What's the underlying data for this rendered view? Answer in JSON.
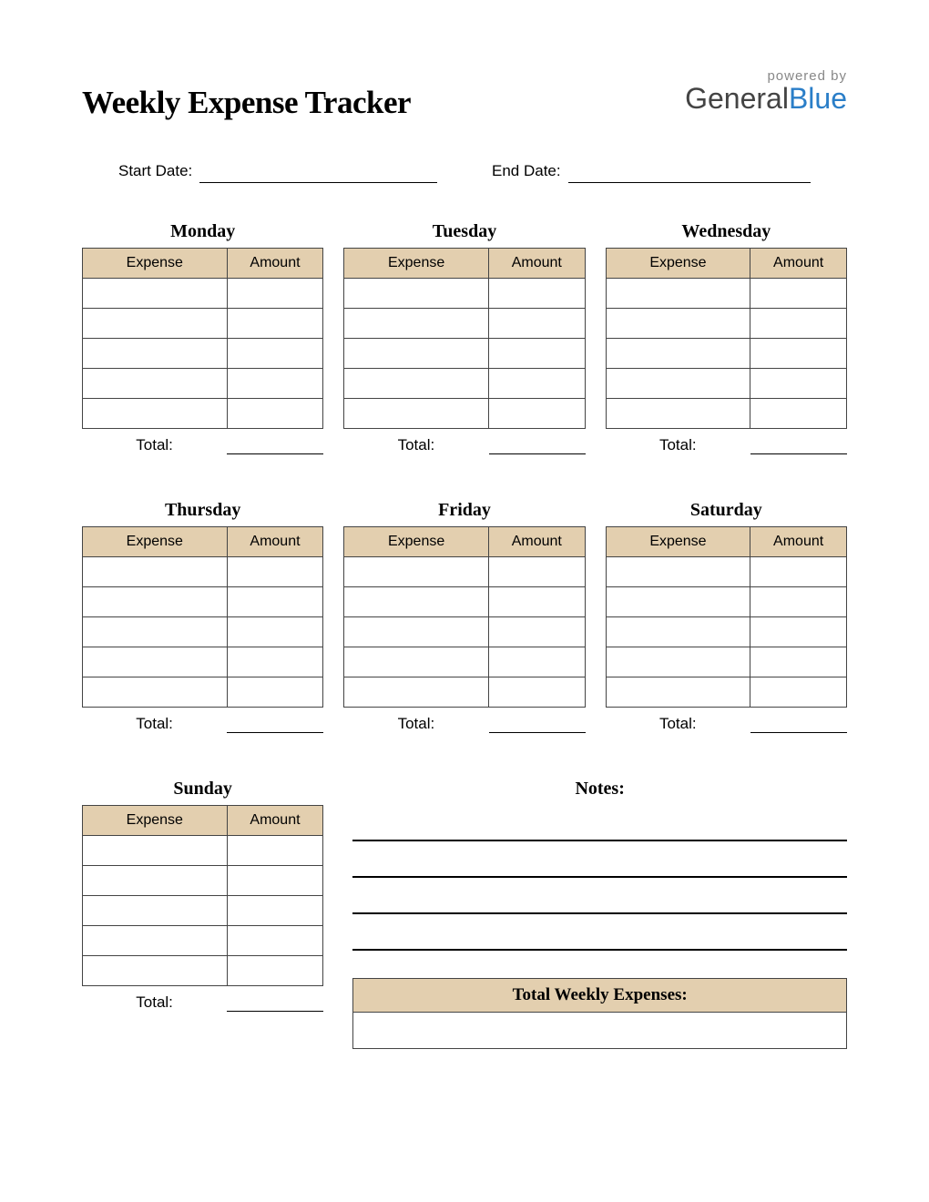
{
  "title": "Weekly Expense Tracker",
  "logo": {
    "powered": "powered by",
    "brand_part1": "General",
    "brand_part2": "Blue"
  },
  "dates": {
    "start_label": "Start Date:",
    "start_value": "",
    "end_label": "End Date:",
    "end_value": ""
  },
  "columns": {
    "expense": "Expense",
    "amount": "Amount"
  },
  "total_label": "Total:",
  "days": [
    {
      "name": "Monday",
      "rows": [
        {
          "expense": "",
          "amount": ""
        },
        {
          "expense": "",
          "amount": ""
        },
        {
          "expense": "",
          "amount": ""
        },
        {
          "expense": "",
          "amount": ""
        },
        {
          "expense": "",
          "amount": ""
        }
      ],
      "total": ""
    },
    {
      "name": "Tuesday",
      "rows": [
        {
          "expense": "",
          "amount": ""
        },
        {
          "expense": "",
          "amount": ""
        },
        {
          "expense": "",
          "amount": ""
        },
        {
          "expense": "",
          "amount": ""
        },
        {
          "expense": "",
          "amount": ""
        }
      ],
      "total": ""
    },
    {
      "name": "Wednesday",
      "rows": [
        {
          "expense": "",
          "amount": ""
        },
        {
          "expense": "",
          "amount": ""
        },
        {
          "expense": "",
          "amount": ""
        },
        {
          "expense": "",
          "amount": ""
        },
        {
          "expense": "",
          "amount": ""
        }
      ],
      "total": ""
    },
    {
      "name": "Thursday",
      "rows": [
        {
          "expense": "",
          "amount": ""
        },
        {
          "expense": "",
          "amount": ""
        },
        {
          "expense": "",
          "amount": ""
        },
        {
          "expense": "",
          "amount": ""
        },
        {
          "expense": "",
          "amount": ""
        }
      ],
      "total": ""
    },
    {
      "name": "Friday",
      "rows": [
        {
          "expense": "",
          "amount": ""
        },
        {
          "expense": "",
          "amount": ""
        },
        {
          "expense": "",
          "amount": ""
        },
        {
          "expense": "",
          "amount": ""
        },
        {
          "expense": "",
          "amount": ""
        }
      ],
      "total": ""
    },
    {
      "name": "Saturday",
      "rows": [
        {
          "expense": "",
          "amount": ""
        },
        {
          "expense": "",
          "amount": ""
        },
        {
          "expense": "",
          "amount": ""
        },
        {
          "expense": "",
          "amount": ""
        },
        {
          "expense": "",
          "amount": ""
        }
      ],
      "total": ""
    },
    {
      "name": "Sunday",
      "rows": [
        {
          "expense": "",
          "amount": ""
        },
        {
          "expense": "",
          "amount": ""
        },
        {
          "expense": "",
          "amount": ""
        },
        {
          "expense": "",
          "amount": ""
        },
        {
          "expense": "",
          "amount": ""
        }
      ],
      "total": ""
    }
  ],
  "notes": {
    "title": "Notes:",
    "lines": [
      "",
      "",
      "",
      ""
    ]
  },
  "weekly_total": {
    "label": "Total Weekly Expenses:",
    "value": ""
  }
}
